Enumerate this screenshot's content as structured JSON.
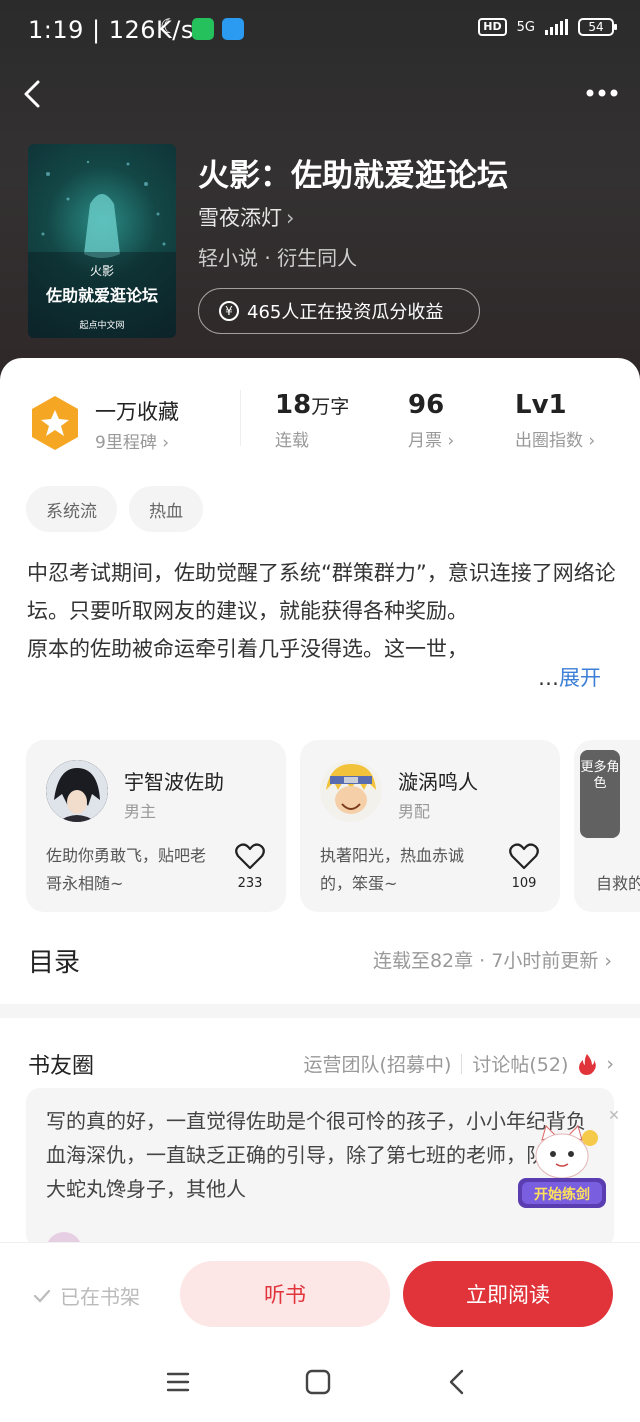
{
  "status_bar": {
    "time": "1:19 | 126K/s",
    "hd": "HD",
    "network": "5G",
    "battery": "54"
  },
  "book": {
    "title": "火影：佐助就爱逛论坛",
    "author": "雪夜添灯",
    "genre": "轻小说 · 衍生同人",
    "invest_text": "465人正在投资瓜分收益",
    "cover": {
      "small": "火影",
      "title": "佐助就爱逛论坛",
      "publisher": "起点中文网"
    }
  },
  "stats": {
    "collect": "一万收藏",
    "collect_sub": "9里程碑",
    "words_num": "18",
    "words_unit": "万字",
    "words_sub": "连载",
    "tickets": "96",
    "tickets_sub": "月票",
    "level": "Lv1",
    "level_sub": "出圈指数"
  },
  "tags": [
    "系统流",
    "热血"
  ],
  "description": {
    "text": "中忍考试期间，佐助觉醒了系统“群策群力”，意识连接了网络论坛。只要听取网友的建议，就能获得各种奖励。\n原本的佐助被命运牵引着几乎没得选。这一世，",
    "ellipsis": "…",
    "expand": "展开"
  },
  "characters": [
    {
      "name": "宇智波佐助",
      "role": "男主",
      "quote": "佐助你勇敢飞，贴吧老哥永相随~",
      "likes": "233"
    },
    {
      "name": "漩涡鸣人",
      "role": "男配",
      "quote": "执著阳光，热血赤诚的，笨蛋~",
      "likes": "109"
    }
  ],
  "more_roles": "更多角色",
  "partial_card_text": "自救的",
  "toc": {
    "title": "目录",
    "info": "连载至82章 · 7小时前更新"
  },
  "circle": {
    "title": "书友圈",
    "ops": "运营团队(招募中)",
    "posts": "讨论帖(52)",
    "post_text": "写的真的好，一直觉得佐助是个很可怜的孩子，小小年纪背负血海深仇，一直缺乏正确的引导，除了第七班的老师，队友，大蛇丸馋身子，其他人",
    "banner": "开始练剑"
  },
  "actions": {
    "shelf": "已在书架",
    "listen": "听书",
    "read": "立即阅读"
  },
  "colors": {
    "accent": "#e0343a",
    "link": "#3d7fd6",
    "medal": "#f5a623"
  }
}
